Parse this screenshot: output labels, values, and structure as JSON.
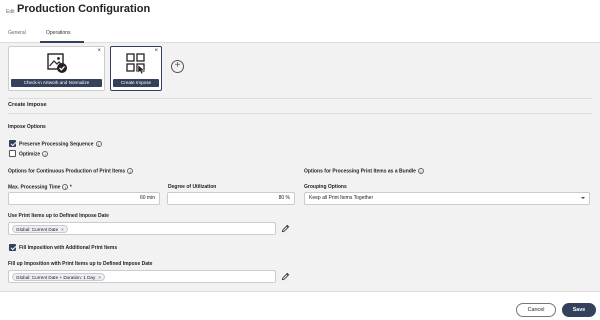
{
  "header": {
    "edit_label": "Edit",
    "title": "Production Configuration",
    "tabs": [
      {
        "label": "General"
      },
      {
        "label": "Operations"
      }
    ]
  },
  "operations": [
    {
      "label": "Check-in Artwork and Normalize",
      "icon": "image-check-icon"
    },
    {
      "label": "Create Impose",
      "icon": "impose-grid-icon"
    }
  ],
  "close_glyph": "×",
  "add_glyph": "+",
  "impose": {
    "section_title": "Create Impose",
    "options_title": "Impose Options",
    "preserve_label": "Preserve Processing Sequence",
    "preserve_checked": true,
    "optimize_label": "Optimize",
    "optimize_checked": false,
    "continuous_title": "Options for Continuous Production of Print Items",
    "bundle_title": "Options for Processing Print Items as a Bundle",
    "max_time_label": "Max. Processing Time",
    "required_mark": "*",
    "max_time_value": "60 min",
    "utilization_label": "Degree of Utilization",
    "utilization_value": "80 %",
    "grouping_label": "Grouping Options",
    "grouping_value": "Keep all Print Items Together",
    "use_items_label": "Use Print Items up to Defined Impose Date",
    "use_items_chip": "Global: Current Date",
    "fill_label": "Fill Imposition with Additional Print Items",
    "fill_checked": true,
    "fill_up_label": "Fill up Imposition with Print Items up to Defined Impose Date",
    "fill_up_chip": "Global: Current Date + Duration: 1 Day",
    "info_glyph": "i"
  },
  "footer": {
    "cancel_label": "Cancel",
    "save_label": "Save"
  },
  "colors": {
    "accent": "#33415c",
    "background": "#f2f2f3"
  }
}
